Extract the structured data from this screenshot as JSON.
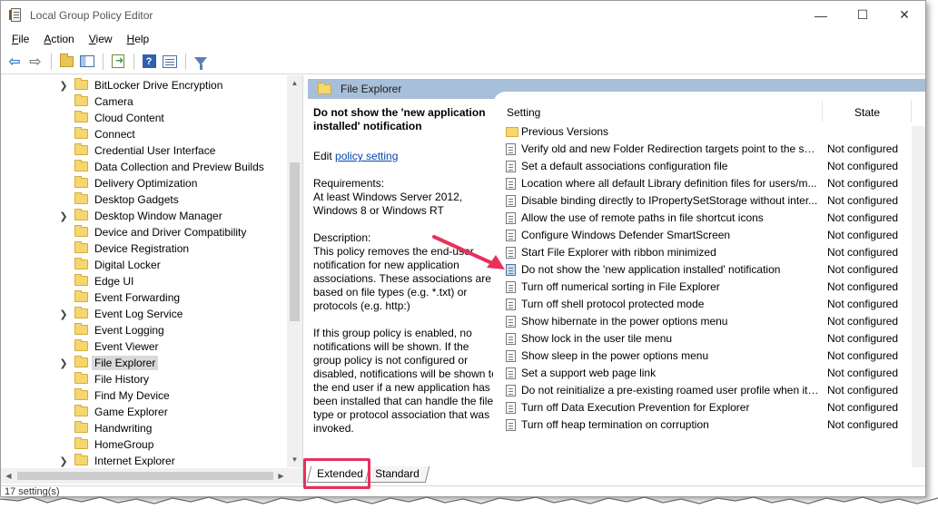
{
  "window": {
    "title": "Local Group Policy Editor",
    "minimize": "—",
    "maximize": "☐",
    "close": "✕"
  },
  "menu": [
    {
      "label": "File",
      "key": "F"
    },
    {
      "label": "Action",
      "key": "A"
    },
    {
      "label": "View",
      "key": "V"
    },
    {
      "label": "Help",
      "key": "H"
    }
  ],
  "toolbar": {
    "back": "back-icon",
    "forward": "forward-icon",
    "up": "up-folder-icon",
    "show_hide": "show-hide-tree-icon",
    "export": "export-list-icon",
    "help": "help-icon",
    "help_glyph": "?",
    "properties": "properties-icon",
    "filter": "filter-icon"
  },
  "tree": {
    "items": [
      {
        "label": "BitLocker Drive Encryption",
        "expandable": true
      },
      {
        "label": "Camera",
        "expandable": false
      },
      {
        "label": "Cloud Content",
        "expandable": false
      },
      {
        "label": "Connect",
        "expandable": false
      },
      {
        "label": "Credential User Interface",
        "expandable": false
      },
      {
        "label": "Data Collection and Preview Builds",
        "expandable": false
      },
      {
        "label": "Delivery Optimization",
        "expandable": false
      },
      {
        "label": "Desktop Gadgets",
        "expandable": false
      },
      {
        "label": "Desktop Window Manager",
        "expandable": true
      },
      {
        "label": "Device and Driver Compatibility",
        "expandable": false
      },
      {
        "label": "Device Registration",
        "expandable": false
      },
      {
        "label": "Digital Locker",
        "expandable": false
      },
      {
        "label": "Edge UI",
        "expandable": false
      },
      {
        "label": "Event Forwarding",
        "expandable": false
      },
      {
        "label": "Event Log Service",
        "expandable": true
      },
      {
        "label": "Event Logging",
        "expandable": false
      },
      {
        "label": "Event Viewer",
        "expandable": false
      },
      {
        "label": "File Explorer",
        "expandable": true,
        "selected": true
      },
      {
        "label": "File History",
        "expandable": false
      },
      {
        "label": "Find My Device",
        "expandable": false
      },
      {
        "label": "Game Explorer",
        "expandable": false
      },
      {
        "label": "Handwriting",
        "expandable": false
      },
      {
        "label": "HomeGroup",
        "expandable": false
      },
      {
        "label": "Internet Explorer",
        "expandable": true
      }
    ],
    "expand_glyph": "❯",
    "scroll_up": "▲",
    "scroll_down": "▼",
    "scroll_left": "◀",
    "scroll_right": "▶"
  },
  "right_pane": {
    "header": "File Explorer",
    "description": {
      "title": "Do not show the 'new application installed' notification",
      "edit_prefix": "Edit ",
      "edit_link": "policy setting ",
      "requirements_label": "Requirements:",
      "requirements": "At least Windows Server 2012, Windows 8 or Windows RT",
      "description_label": "Description:",
      "paragraph1": "This policy removes the end-user notification for new application associations. These associations are based on file types (e.g. *.txt) or protocols (e.g. http:)",
      "paragraph2": "If this group policy is enabled, no notifications will be shown. If the group policy is not configured or disabled, notifications will be shown to the end user if a new application has been installed that can handle the file type or protocol association that was invoked."
    },
    "columns": {
      "setting": "Setting",
      "state": "State"
    },
    "rows": [
      {
        "name": "Previous Versions",
        "state": "",
        "type": "folder"
      },
      {
        "name": "Verify old and new Folder Redirection targets point to the sa...",
        "state": "Not configured",
        "type": "policy"
      },
      {
        "name": "Set a default associations configuration file",
        "state": "Not configured",
        "type": "policy"
      },
      {
        "name": "Location where all default Library definition files for users/m...",
        "state": "Not configured",
        "type": "policy"
      },
      {
        "name": "Disable binding directly to IPropertySetStorage without inter...",
        "state": "Not configured",
        "type": "policy"
      },
      {
        "name": "Allow the use of remote paths in file shortcut icons",
        "state": "Not configured",
        "type": "policy"
      },
      {
        "name": "Configure Windows Defender SmartScreen",
        "state": "Not configured",
        "type": "policy"
      },
      {
        "name": "Start File Explorer with ribbon minimized",
        "state": "Not configured",
        "type": "policy"
      },
      {
        "name": "Do not show the 'new application installed' notification",
        "state": "Not configured",
        "type": "policy",
        "selected": true
      },
      {
        "name": "Turn off numerical sorting in File Explorer",
        "state": "Not configured",
        "type": "policy"
      },
      {
        "name": "Turn off shell protocol protected mode",
        "state": "Not configured",
        "type": "policy"
      },
      {
        "name": "Show hibernate in the power options menu",
        "state": "Not configured",
        "type": "policy"
      },
      {
        "name": "Show lock in the user tile menu",
        "state": "Not configured",
        "type": "policy"
      },
      {
        "name": "Show sleep in the power options menu",
        "state": "Not configured",
        "type": "policy"
      },
      {
        "name": "Set a support web page link",
        "state": "Not configured",
        "type": "policy"
      },
      {
        "name": "Do not reinitialize a pre-existing roamed user profile when it ...",
        "state": "Not configured",
        "type": "policy"
      },
      {
        "name": "Turn off Data Execution Prevention for Explorer",
        "state": "Not configured",
        "type": "policy"
      },
      {
        "name": "Turn off heap termination on corruption",
        "state": "Not configured",
        "type": "policy"
      }
    ]
  },
  "tabs": [
    {
      "label": "Extended",
      "active": true
    },
    {
      "label": "Standard",
      "active": false
    }
  ],
  "status": "17 setting(s)",
  "annotation_color": "#e8305b"
}
